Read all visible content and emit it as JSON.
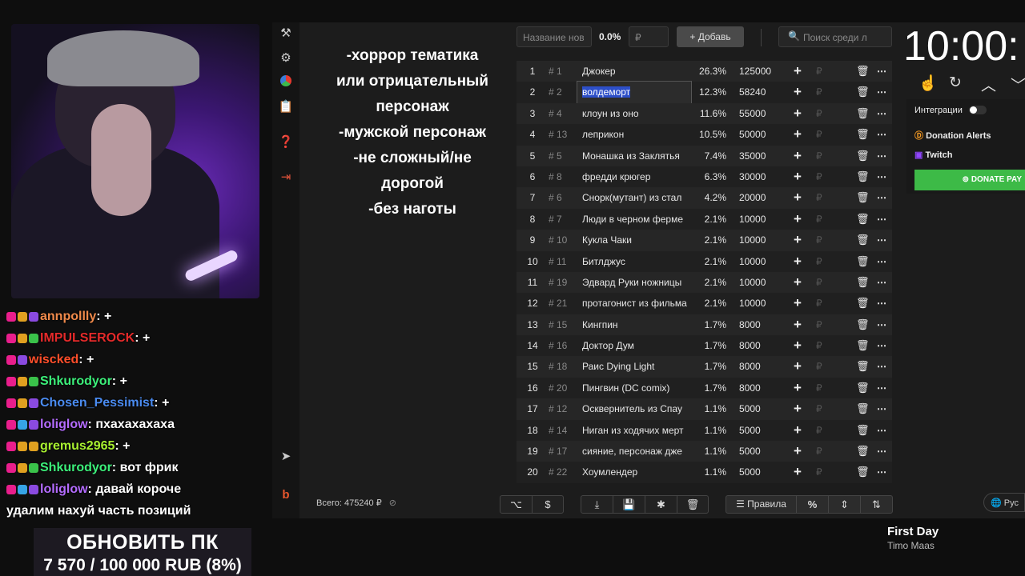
{
  "note": {
    "lines": [
      "-хоррор тематика",
      "или отрицательный",
      "персонаж",
      "-мужской персонаж",
      "-не сложный/не",
      "дорогой",
      "-без наготы"
    ]
  },
  "chat": [
    {
      "user": "annpollly",
      "color": "#f08a4b",
      "msg": "+"
    },
    {
      "user": "IMPULSEROCK",
      "color": "#e52a2a",
      "msg": "+"
    },
    {
      "user": "wiscked",
      "color": "#ff4e2a",
      "msg": "+"
    },
    {
      "user": "Shkurodyor",
      "color": "#3cf07a",
      "msg": "+"
    },
    {
      "user": "Chosen_Pessimist",
      "color": "#4a8bf0",
      "msg": "+"
    },
    {
      "user": "loliglow",
      "color": "#b46cff",
      "msg": "пхахахахаха"
    },
    {
      "user": "gremus2965",
      "color": "#a8f030",
      "msg": "+"
    },
    {
      "user": "Shkurodyor",
      "color": "#3cf07a",
      "msg": "вот фрик"
    },
    {
      "user": "loliglow",
      "color": "#b46cff",
      "msg": "давай короче"
    }
  ],
  "chat_continuation": "удалим нахуй часть позиций",
  "goal": {
    "title": "ОБНОВИТЬ ПК",
    "progress_text": "7 570 / 100 000 RUB (8%)",
    "progress": 0.08
  },
  "toolbar": {
    "name_placeholder": "Название нов",
    "percent": "0.0%",
    "currency": "₽",
    "add_label": "+ Добавь",
    "search_placeholder": "Поиск среди л"
  },
  "rows": [
    {
      "n": "1",
      "id": "# 1",
      "name": "Джокер",
      "pct": "26.3%",
      "amount": "125000"
    },
    {
      "n": "2",
      "id": "# 2",
      "name": "волдеморт",
      "pct": "12.3%",
      "amount": "58240"
    },
    {
      "n": "3",
      "id": "# 4",
      "name": "клоун из оно",
      "pct": "11.6%",
      "amount": "55000"
    },
    {
      "n": "4",
      "id": "# 13",
      "name": "леприкон",
      "pct": "10.5%",
      "amount": "50000"
    },
    {
      "n": "5",
      "id": "# 5",
      "name": "Монашка из Заклятья",
      "pct": "7.4%",
      "amount": "35000"
    },
    {
      "n": "6",
      "id": "# 8",
      "name": "фредди крюгер",
      "pct": "6.3%",
      "amount": "30000"
    },
    {
      "n": "7",
      "id": "# 6",
      "name": "Снорк(мутант) из стал",
      "pct": "4.2%",
      "amount": "20000"
    },
    {
      "n": "8",
      "id": "# 7",
      "name": "Люди в черном ферме",
      "pct": "2.1%",
      "amount": "10000"
    },
    {
      "n": "9",
      "id": "# 10",
      "name": "Кукла Чаки",
      "pct": "2.1%",
      "amount": "10000"
    },
    {
      "n": "10",
      "id": "# 11",
      "name": "Битлджус",
      "pct": "2.1%",
      "amount": "10000"
    },
    {
      "n": "11",
      "id": "# 19",
      "name": "Эдвард Руки ножницы",
      "pct": "2.1%",
      "amount": "10000"
    },
    {
      "n": "12",
      "id": "# 21",
      "name": "протагонист из фильма",
      "pct": "2.1%",
      "amount": "10000"
    },
    {
      "n": "13",
      "id": "# 15",
      "name": "Кингпин",
      "pct": "1.7%",
      "amount": "8000"
    },
    {
      "n": "14",
      "id": "# 16",
      "name": "Доктор Дум",
      "pct": "1.7%",
      "amount": "8000"
    },
    {
      "n": "15",
      "id": "# 18",
      "name": "Раис Dying Light",
      "pct": "1.7%",
      "amount": "8000"
    },
    {
      "n": "16",
      "id": "# 20",
      "name": "Пингвин (DC comix)",
      "pct": "1.7%",
      "amount": "8000"
    },
    {
      "n": "17",
      "id": "# 12",
      "name": "Осквернитель из Спау",
      "pct": "1.1%",
      "amount": "5000"
    },
    {
      "n": "18",
      "id": "# 14",
      "name": "Ниган из ходячих мерт",
      "pct": "1.1%",
      "amount": "5000"
    },
    {
      "n": "19",
      "id": "# 17",
      "name": "сияние, персонаж дже",
      "pct": "1.1%",
      "amount": "5000"
    },
    {
      "n": "20",
      "id": "# 22",
      "name": "Хоумлендер",
      "pct": "1.1%",
      "amount": "5000"
    }
  ],
  "row_currency": "₽",
  "footer": {
    "total": "Всего: 475240 ₽",
    "rules_label": "Правила",
    "percent_symbol": "%"
  },
  "timer": "10:00:",
  "integrations": {
    "title": "Интеграции",
    "donation_alerts": "Donation Alerts",
    "twitch": "Twitch",
    "donate_pay": "DONATE PAY"
  },
  "language": "Рус",
  "now_playing": {
    "title": "First Day",
    "artist": "Timo Maas"
  },
  "colors": {
    "accent_green": "#3dba47",
    "selection_blue": "#2d4fc8",
    "logout_red": "#e0523a",
    "brand_orange": "#e8572d"
  }
}
